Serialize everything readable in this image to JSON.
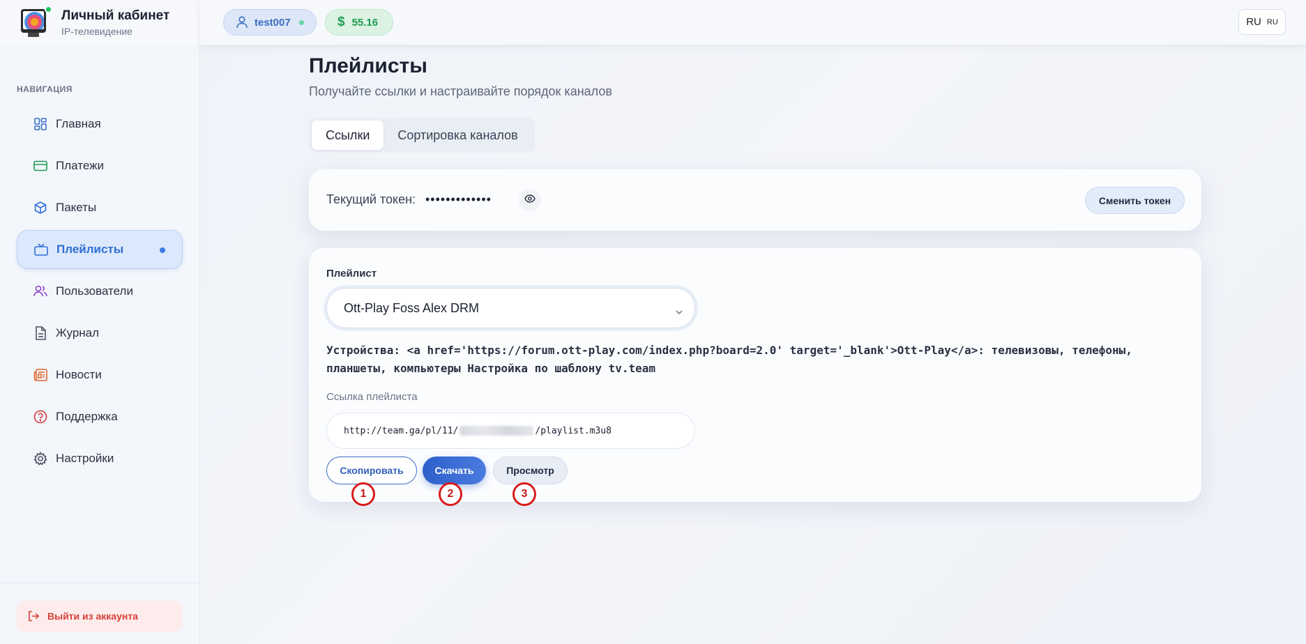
{
  "brand": {
    "title": "Личный кабинет",
    "subtitle": "IP-телевидение"
  },
  "sidebar": {
    "caption": "НАВИГАЦИЯ",
    "items": [
      {
        "label": "Главная",
        "icon": "dashboard-icon"
      },
      {
        "label": "Платежи",
        "icon": "credit-card-icon"
      },
      {
        "label": "Пакеты",
        "icon": "package-icon"
      },
      {
        "label": "Плейлисты",
        "icon": "tv-icon",
        "active": true
      },
      {
        "label": "Пользователи",
        "icon": "users-icon"
      },
      {
        "label": "Журнал",
        "icon": "document-icon"
      },
      {
        "label": "Новости",
        "icon": "newspaper-icon"
      },
      {
        "label": "Поддержка",
        "icon": "help-icon"
      },
      {
        "label": "Настройки",
        "icon": "gear-icon"
      }
    ],
    "logout_label": "Выйти из аккаунта"
  },
  "topbar": {
    "username": "test007",
    "balance": "55.16",
    "lang_main": "RU",
    "lang_small": "RU"
  },
  "page": {
    "title": "Плейлисты",
    "subtitle": "Получайте ссылки и настраивайте порядок каналов",
    "tabs": [
      {
        "label": "Ссылки",
        "active": true
      },
      {
        "label": "Сортировка каналов",
        "active": false
      }
    ]
  },
  "token": {
    "label": "Текущий токен:",
    "value": "•••••••••••••",
    "change_label": "Сменить токен"
  },
  "playlist": {
    "label": "Плейлист",
    "selected": "Ott-Play Foss Alex DRM",
    "devices_text": "Устройства: <a href='https://forum.ott-play.com/index.php?board=2.0' target='_blank'>Ott-Play</a>: телевизовы, телефоны, планшеты, компьютеры Настройка по шаблону tv.team",
    "link_label": "Ссылка плейлиста",
    "link_prefix": "http://team.ga/pl/11/",
    "link_suffix": "/playlist.m3u8",
    "copy_label": "Скопировать",
    "download_label": "Скачать",
    "view_label": "Просмотр"
  },
  "markers": [
    "1",
    "2",
    "3"
  ],
  "colors": {
    "accent": "#3b7be5",
    "success": "#1f9a52",
    "danger": "#d7403a",
    "marker": "#d81b1b"
  }
}
